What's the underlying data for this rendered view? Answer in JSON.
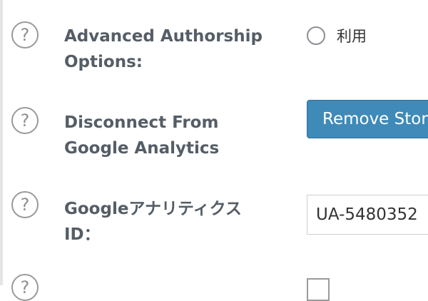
{
  "settings": {
    "help_symbol": "?",
    "authorship": {
      "label": "Advanced Authorship\nOptions:",
      "option_label": "利用"
    },
    "disconnect": {
      "label": "Disconnect From\nGoogle Analytics",
      "button_label": "Remove Stored"
    },
    "analytics_id": {
      "label": "Googleアナリティクス\nID：",
      "value": "UA-5480352"
    }
  }
}
